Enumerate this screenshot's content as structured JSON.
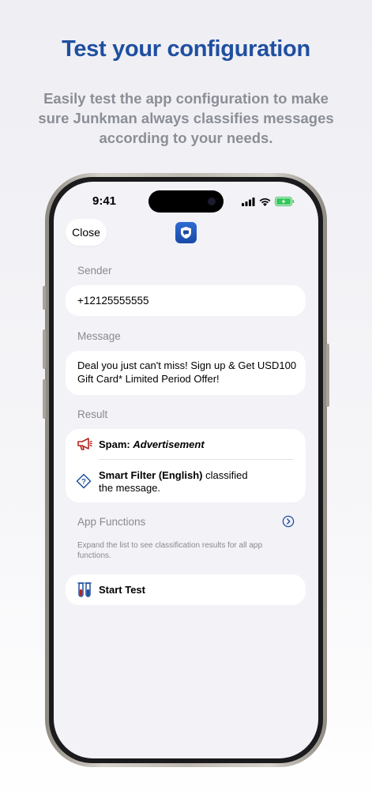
{
  "header": {
    "title": "Test your configuration",
    "subtitle": "Easily test the app configuration to make sure Junkman always classifies messages according to your needs."
  },
  "status_bar": {
    "time": "9:41"
  },
  "toolbar": {
    "close_label": "Close",
    "app_icon": "junkman-shield-icon"
  },
  "sender": {
    "label": "Sender",
    "value": "+12125555555"
  },
  "message": {
    "label": "Message",
    "value": "Deal you just can't miss! Sign up & Get USD100 Gift Card* Limited Period Offer!"
  },
  "result": {
    "label": "Result",
    "category": "Spam:",
    "subcategory": "Advertisement",
    "category_icon": "megaphone-icon",
    "filter_name": "Smart Filter (English)",
    "filter_text_1": "classified",
    "filter_text_2": "the message.",
    "filter_icon": "question-diamond-icon"
  },
  "app_functions": {
    "label": "App Functions",
    "hint": "Expand the list to see classification results for all app functions.",
    "expand_icon": "chevron-right-circle-icon"
  },
  "start_test": {
    "label": "Start Test",
    "icon": "test-tubes-icon"
  },
  "colors": {
    "accent": "#1f4fa0",
    "spam_red": "#b3261e",
    "battery_green": "#34c759"
  }
}
